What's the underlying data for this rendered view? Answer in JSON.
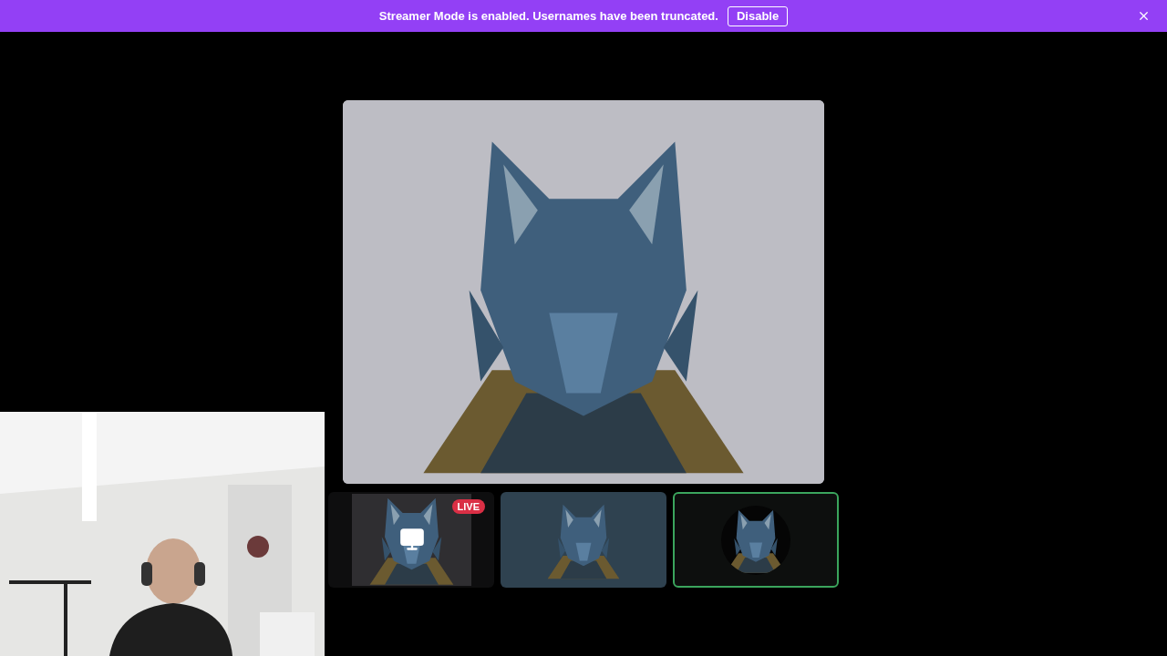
{
  "banner": {
    "message": "Streamer Mode is enabled. Usernames have been truncated.",
    "button": "Disable"
  },
  "thumbnails": [
    {
      "kind": "stream",
      "badge": "LIVE",
      "speaking": false
    },
    {
      "kind": "avatar",
      "speaking": false
    },
    {
      "kind": "round-avatar",
      "speaking": true
    }
  ]
}
